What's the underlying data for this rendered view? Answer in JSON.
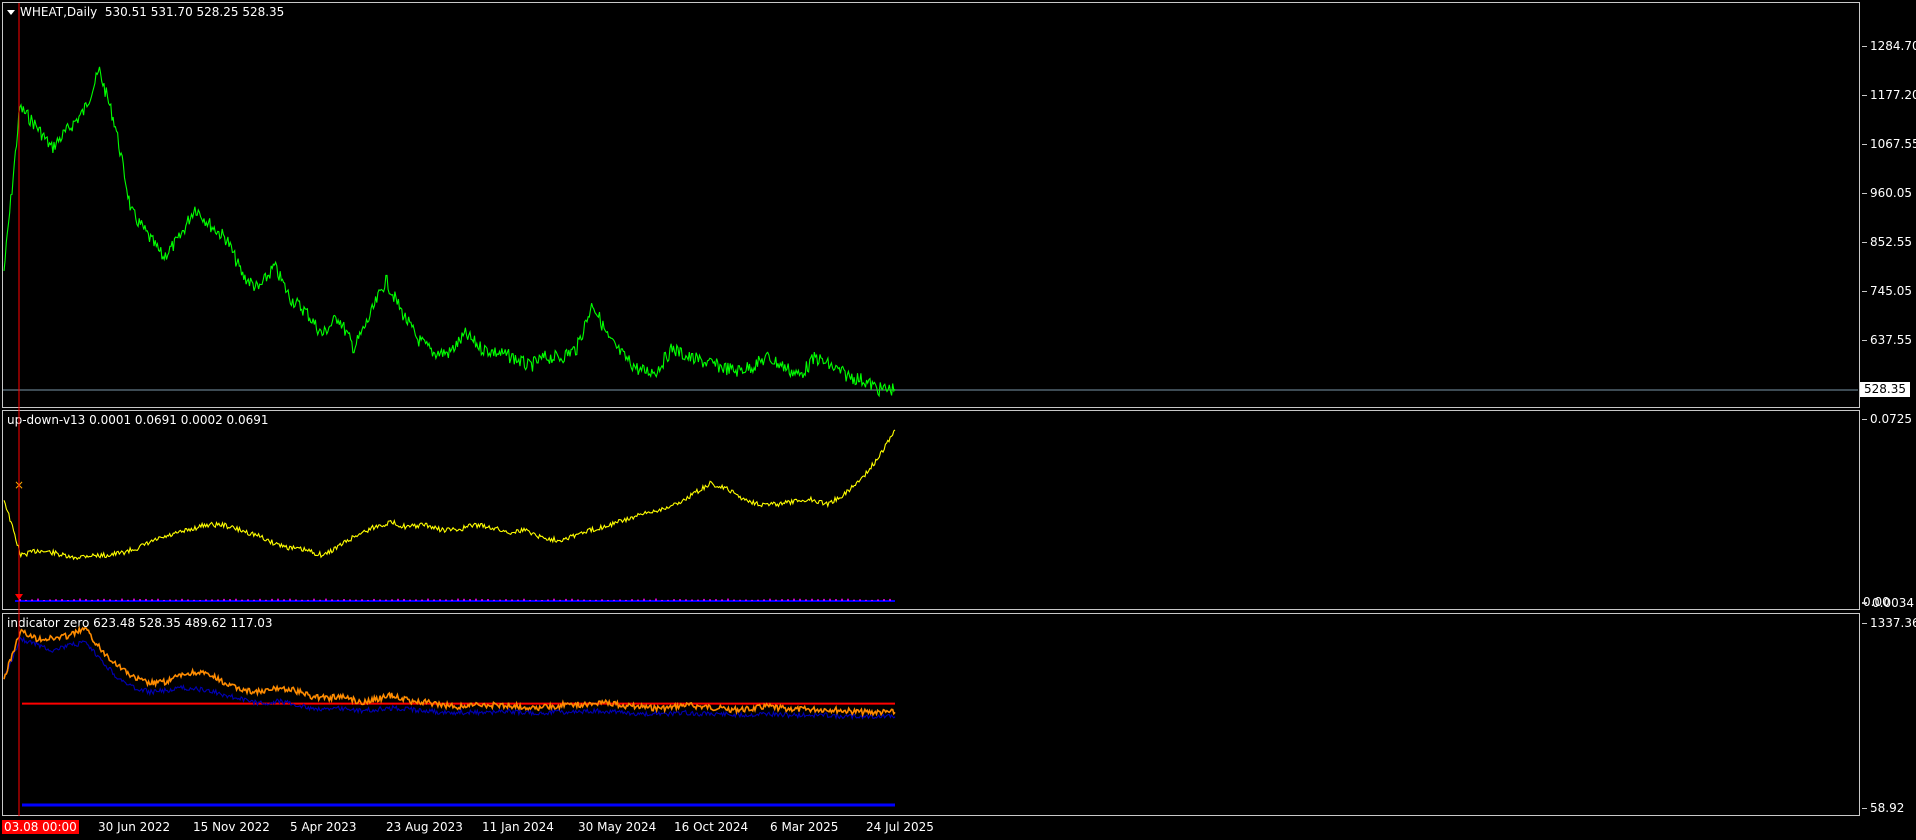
{
  "panes": {
    "main": {
      "symbol": "WHEAT,Daily",
      "values": "530.51 531.70 528.25 528.35",
      "y_ticks": [
        "1284.70",
        "1177.20",
        "1067.55",
        "960.05",
        "852.55",
        "745.05",
        "637.55"
      ],
      "price_tag": "528.35"
    },
    "ind1": {
      "label": "up-down-v13 0.0001 0.0691 0.0002 0.0691",
      "y_ticks": [
        "0.0725",
        "0.0034"
      ],
      "y_tick_overlap": "0.00"
    },
    "ind2": {
      "label": "indicator zero 623.48 528.35 489.62 117.03",
      "y_ticks": [
        "1337.36",
        "58.92"
      ]
    }
  },
  "x_axis": {
    "labels": [
      "03.08 00:00",
      "30 Jun 2022",
      "15 Nov 2022",
      "5 Apr 2023",
      "23 Aug 2023",
      "11 Jan 2024",
      "30 May 2024",
      "16 Oct 2024",
      "6 Mar 2025",
      "24 Jul 2025"
    ]
  },
  "colors": {
    "price_line": "#00ff00",
    "indicator1_line": "#ffff00",
    "indicator1_marker": "#ffa500",
    "indicator1_baseline": "#0000ff",
    "indicator1_histogram": "#ff00ff",
    "indicator2_fast": "#ff8c00",
    "indicator2_slow": "#0000b4",
    "indicator2_upper": "#ff0000",
    "indicator2_lower": "#0000ff",
    "cursor_line": "#ff0000",
    "background": "#000000"
  },
  "chart_data": [
    {
      "type": "line",
      "title": "WHEAT,Daily",
      "series": [
        {
          "name": "WHEAT",
          "values": [
            790,
            1150,
            1110,
            1060,
            1100,
            1140,
            1230,
            1110,
            920,
            870,
            820,
            860,
            930,
            890,
            860,
            780,
            750,
            800,
            730,
            700,
            650,
            690,
            620,
            690,
            770,
            700,
            640,
            610,
            610,
            650,
            620,
            610,
            600,
            580,
            600,
            600,
            620,
            720,
            640,
            600,
            570,
            570,
            620,
            600,
            590,
            580,
            570,
            580,
            600,
            580,
            560,
            600,
            580,
            560,
            550,
            530,
            530
          ]
        }
      ],
      "ylim": [
        528.35,
        1284.7
      ]
    },
    {
      "type": "line",
      "title": "up-down-v13",
      "series": [
        {
          "name": "up-down-v13",
          "values": [
            0.042,
            0.02,
            0.022,
            0.021,
            0.019,
            0.02,
            0.02,
            0.021,
            0.023,
            0.026,
            0.028,
            0.03,
            0.032,
            0.032,
            0.03,
            0.028,
            0.025,
            0.023,
            0.022,
            0.02,
            0.024,
            0.028,
            0.031,
            0.033,
            0.031,
            0.032,
            0.03,
            0.03,
            0.032,
            0.031,
            0.029,
            0.03,
            0.027,
            0.026,
            0.028,
            0.03,
            0.032,
            0.034,
            0.036,
            0.038,
            0.04,
            0.044,
            0.048,
            0.046,
            0.042,
            0.04,
            0.04,
            0.041,
            0.042,
            0.04,
            0.044,
            0.05,
            0.058,
            0.069
          ]
        }
      ],
      "ylim": [
        0.0034,
        0.0725
      ]
    },
    {
      "type": "line",
      "title": "indicator zero",
      "series": [
        {
          "name": "indicator zero",
          "values": [
            950,
            1280,
            1230,
            1230,
            1250,
            1300,
            1150,
            1050,
            960,
            920,
            930,
            980,
            1000,
            960,
            900,
            870,
            860,
            890,
            870,
            830,
            820,
            830,
            790,
            810,
            840,
            800,
            790,
            770,
            760,
            770,
            770,
            770,
            760,
            750,
            760,
            780,
            770,
            800,
            770,
            760,
            750,
            750,
            770,
            760,
            750,
            740,
            740,
            760,
            750,
            740,
            740,
            740,
            730,
            720,
            720,
            720
          ]
        },
        {
          "name": "indicator zero",
          "values": [
            950,
            1230,
            1190,
            1150,
            1180,
            1200,
            1080,
            960,
            890,
            860,
            870,
            890,
            880,
            860,
            830,
            800,
            780,
            800,
            770,
            750,
            740,
            750,
            730,
            740,
            750,
            740,
            730,
            720,
            720,
            720,
            720,
            730,
            720,
            710,
            720,
            720,
            730,
            730,
            720,
            710,
            710,
            710,
            720,
            710,
            710,
            700,
            700,
            710,
            700,
            700,
            700,
            700,
            690,
            690,
            690,
            690
          ]
        }
      ],
      "lines": [
        780,
        80
      ],
      "ylim": [
        58.92,
        1337.36
      ]
    }
  ]
}
